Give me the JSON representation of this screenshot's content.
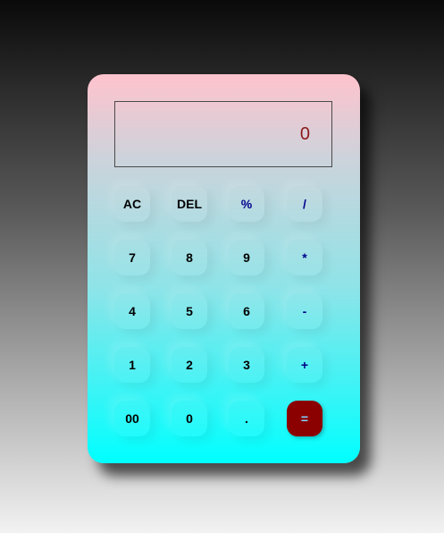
{
  "display": {
    "value": "0"
  },
  "keys": {
    "ac": "AC",
    "del": "DEL",
    "percent": "%",
    "divide": "/",
    "seven": "7",
    "eight": "8",
    "nine": "9",
    "multiply": "*",
    "four": "4",
    "five": "5",
    "six": "6",
    "subtract": "-",
    "one": "1",
    "two": "2",
    "three": "3",
    "add": "+",
    "double_zero": "00",
    "zero": "0",
    "decimal": ".",
    "equals": "="
  },
  "colors": {
    "equals_background": "#8b0000",
    "equals_text": "#7fd6ff",
    "operator_text": "#00008b",
    "display_text": "#8b1a1a"
  }
}
